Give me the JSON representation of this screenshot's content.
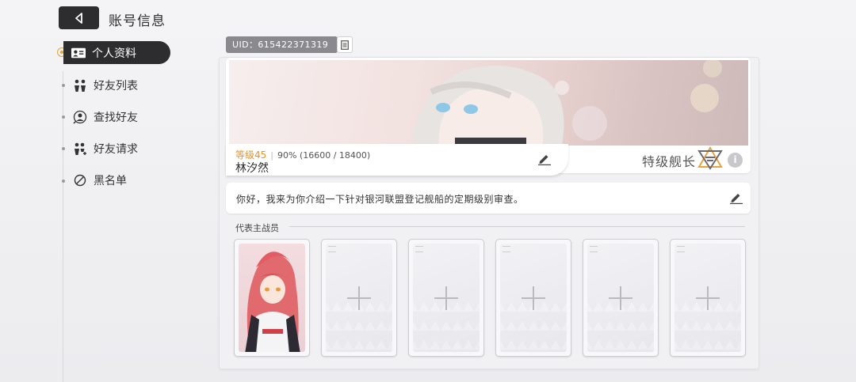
{
  "header": {
    "title": "账号信息"
  },
  "nav": {
    "items": [
      {
        "label": "个人资料",
        "icon": "id-card-icon",
        "active": true
      },
      {
        "label": "好友列表",
        "icon": "friends-icon"
      },
      {
        "label": "查找好友",
        "icon": "find-friend-icon"
      },
      {
        "label": "好友请求",
        "icon": "friend-request-icon"
      },
      {
        "label": "黑名单",
        "icon": "blacklist-icon"
      }
    ]
  },
  "profile": {
    "uid": "UID：615422371319",
    "level_label": "等级45",
    "exp_text": "90% (16600 / 18400)",
    "name": "林汐然",
    "rank": "特级舰长",
    "signature": "你好，我来为你介绍一下针对银河联盟登记舰船的定期级别审查。"
  },
  "representatives": {
    "label": "代表主战员",
    "slots": [
      {
        "filled": true,
        "icon": "character-portrait"
      },
      {
        "filled": false,
        "icon": "plus-icon"
      },
      {
        "filled": false,
        "icon": "plus-icon"
      },
      {
        "filled": false,
        "icon": "plus-icon"
      },
      {
        "filled": false,
        "icon": "plus-icon"
      },
      {
        "filled": false,
        "icon": "plus-icon"
      }
    ]
  },
  "colors": {
    "accent": "#e8932a",
    "dark": "#2d2d2f"
  }
}
